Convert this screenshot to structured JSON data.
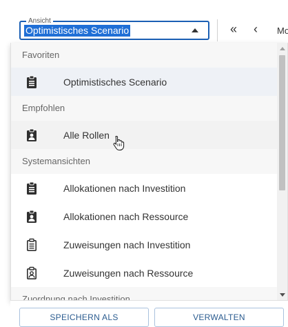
{
  "toolbar": {
    "view_field": {
      "legend": "Ansicht",
      "value": "Optimistisches Scenario"
    },
    "nav": {
      "first": "«",
      "prev": "‹",
      "next_partial": "Mo"
    }
  },
  "dropdown": {
    "groups": [
      {
        "header": "Favoriten",
        "items": [
          {
            "label": "Optimistisches Scenario",
            "icon": "clipboard-icon",
            "state": "selected"
          }
        ]
      },
      {
        "header": "Empfohlen",
        "items": [
          {
            "label": "Alle Rollen",
            "icon": "clipboard-user-icon",
            "state": "hover"
          }
        ]
      },
      {
        "header": "Systemansichten",
        "items": [
          {
            "label": "Allokationen nach Investition",
            "icon": "clipboard-icon"
          },
          {
            "label": "Allokationen nach Ressource",
            "icon": "clipboard-user-icon"
          },
          {
            "label": "Zuweisungen nach Investition",
            "icon": "clipboard-outline-icon"
          },
          {
            "label": "Zuweisungen nach Ressource",
            "icon": "clipboard-user-outline-icon"
          }
        ]
      },
      {
        "header": "Zuordnung nach Investition",
        "items": []
      }
    ]
  },
  "footer": {
    "save_as_label": "SPEICHERN ALS",
    "manage_label": "VERWALTEN"
  },
  "colors": {
    "accent": "#1a5fb4",
    "selection": "#1f6fd6",
    "button_text": "#2a5b8f",
    "icon": "#2f2f2f"
  }
}
